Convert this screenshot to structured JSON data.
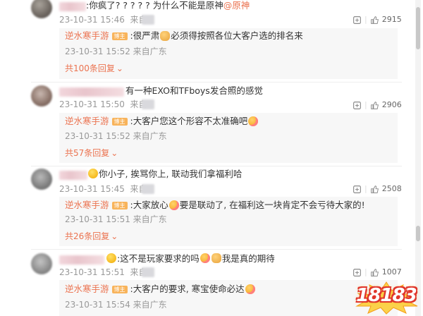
{
  "comments": [
    {
      "text_pre": ":你疯了? ? ? ? ?  为什么不能是原神",
      "mention": "@原神",
      "time": "23-10-31 15:46",
      "from": "来自",
      "shares": "",
      "likes": "2915",
      "reply": {
        "name": "逆水寒手游",
        "badge": "博主",
        "text_a": ":很严肃",
        "text_b": "必须得按照各位大客户选的排名来",
        "time": "23-10-31 15:52 来自广东"
      },
      "more": "共100条回复"
    },
    {
      "text_pre": "有一种EXO和TFboys发合照的感觉",
      "mention": "",
      "time": "23-10-31 15:50",
      "from": "来自",
      "likes": "2906",
      "reply": {
        "name": "逆水寒手游",
        "badge": "博主",
        "text_a": ":大客户您这个形容不太准确吧",
        "text_b": "",
        "time": "23-10-31 15:52 来自广东"
      },
      "more": "共57条回复"
    },
    {
      "text_pre": "你小子, 挨骂你上, 联动我们拿福利哈",
      "mention": "",
      "time": "23-10-31 15:45",
      "from": "来自",
      "likes": "2508",
      "reply": {
        "name": "逆水寒手游",
        "badge": "博主",
        "text_a": ":大家放心",
        "text_b": "要是联动了, 在福利这一块肯定不会亏待大家的!",
        "time": "23-10-31 15:51 来自广东"
      },
      "more": "共26条回复"
    },
    {
      "text_pre": ":这不是玩家要求的吗",
      "text_b": "我是真的期待",
      "mention": "",
      "time": "23-10-31 15:51",
      "from": "来自",
      "likes": "1007",
      "reply": {
        "name": "逆水寒手游",
        "badge": "博主",
        "text_a": ":大客户的要求, 寒宝使命必达",
        "text_b": "",
        "time": "23-10-31 15:54 来自广东"
      },
      "more": ""
    }
  ],
  "watermark": "18183",
  "colors": {
    "accent": "#eb7350",
    "meta": "#999999",
    "reply_bg": "#f7f7f7",
    "badge": "#f8b35a"
  }
}
